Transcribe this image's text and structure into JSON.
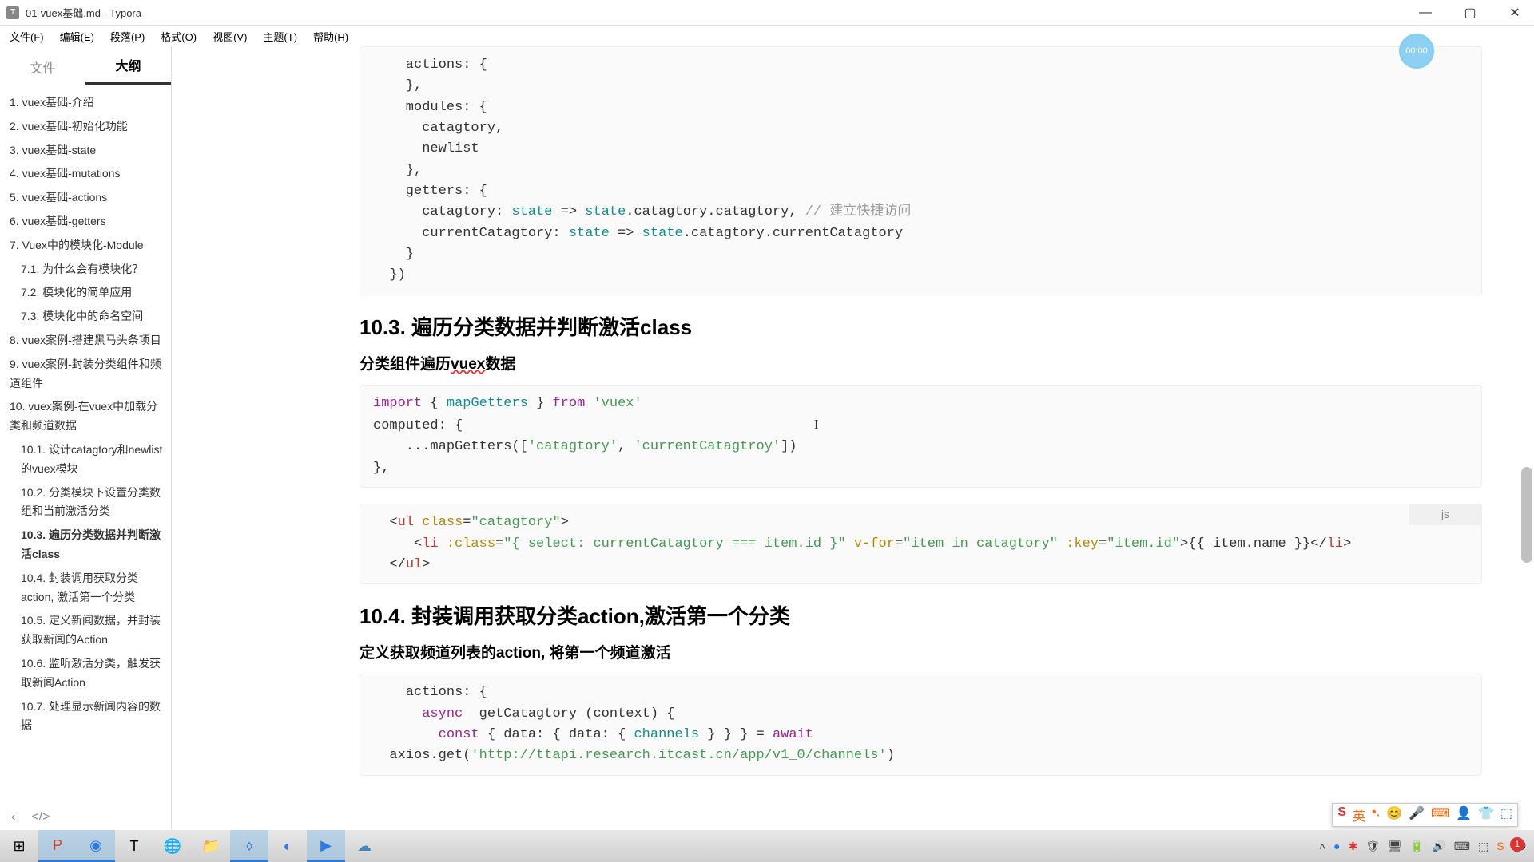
{
  "window": {
    "title": "01-vuex基础.md - Typora"
  },
  "menu": [
    "文件(F)",
    "编辑(E)",
    "段落(P)",
    "格式(O)",
    "视图(V)",
    "主题(T)",
    "帮助(H)"
  ],
  "sidebar": {
    "tabs": {
      "files": "文件",
      "outline": "大纲"
    },
    "items": [
      {
        "t": "1.  vuex基础-介绍",
        "l": 1
      },
      {
        "t": "2.  vuex基础-初始化功能",
        "l": 1
      },
      {
        "t": "3.  vuex基础-state",
        "l": 1
      },
      {
        "t": "4.  vuex基础-mutations",
        "l": 1
      },
      {
        "t": "5.  vuex基础-actions",
        "l": 1
      },
      {
        "t": "6.  vuex基础-getters",
        "l": 1
      },
      {
        "t": "7.  Vuex中的模块化-Module",
        "l": 1
      },
      {
        "t": "7.1.  为什么会有模块化？",
        "l": 2
      },
      {
        "t": "7.2.  模块化的简单应用",
        "l": 2
      },
      {
        "t": "7.3.  模块化中的命名空间",
        "l": 2
      },
      {
        "t": "8.  vuex案例-搭建黑马头条项目",
        "l": 1
      },
      {
        "t": "9.  vuex案例-封装分类组件和频道组件",
        "l": 1
      },
      {
        "t": "10.  vuex案例-在vuex中加载分类和频道数据",
        "l": 1
      },
      {
        "t": "10.1.  设计catagtory和newlist的vuex模块",
        "l": 2
      },
      {
        "t": "10.2.  分类模块下设置分类数组和当前激活分类",
        "l": 2
      },
      {
        "t": "10.3.  遍历分类数据并判断激活class",
        "l": 2,
        "a": true
      },
      {
        "t": "10.4.  封装调用获取分类action, 激活第一个分类",
        "l": 2
      },
      {
        "t": "10.5.  定义新闻数据，并封装获取新闻的Action",
        "l": 2
      },
      {
        "t": "10.6.  监听激活分类，触发获取新闻Action",
        "l": 2
      },
      {
        "t": "10.7.  处理显示新闻内容的数据",
        "l": 2
      }
    ]
  },
  "float": {
    "timer": "00:00"
  },
  "content": {
    "h2_103": "10.3. 遍历分类数据并判断激活class",
    "sub_103_a": "分类组件遍历",
    "sub_103_b": "vuex",
    "sub_103_c": "数据",
    "code2_lang": "js",
    "h2_104": "10.4. 封装调用获取分类action,激活第一个分类",
    "sub_104": "定义获取频道列表的action,  将第一个频道激活",
    "code0": {
      "l1a": "    actions: {",
      "l1b": "    },",
      "l2a": "    modules: {",
      "l2b": "      catagtory,",
      "l2c": "      newlist",
      "l2d": "    },",
      "l3a": "    getters: {",
      "l3b_a": "      catagtory: ",
      "l3b_b": "state",
      "l3b_c": " => ",
      "l3b_d": "state",
      "l3b_e": ".catagtory.catagtory, ",
      "l3b_f": "// 建立快捷访问",
      "l3c_a": "      currentCatagtory: ",
      "l3c_b": "state",
      "l3c_c": " => ",
      "l3c_d": "state",
      "l3c_e": ".catagtory.currentCatagtory",
      "l3d": "    }",
      "l4": "  })"
    },
    "code1": {
      "l1_a": "import",
      "l1_b": " { ",
      "l1_c": "mapGetters",
      "l1_d": " } ",
      "l1_e": "from",
      "l1_f": " 'vuex'",
      "l2": "computed: {",
      "l3_a": "    ...mapGetters([",
      "l3_b": "'catagtory'",
      "l3_c": ", ",
      "l3_d": "'currentCatagtroy'",
      "l3_e": "])",
      "l4": "},"
    },
    "code2": {
      "l1_a": "  <",
      "l1_b": "ul",
      "l1_c": " class",
      "l1_d": "=",
      "l1_e": "\"catagtory\"",
      "l1_f": ">",
      "l2_a": "     <",
      "l2_b": "li",
      "l2_c": " :class",
      "l2_d": "=",
      "l2_e": "\"{ select: currentCatagtory === item.id }\"",
      "l2_f": " v-for",
      "l2_g": "=",
      "l2_h": "\"item in catagtory\"",
      "l2_i": " :key",
      "l2_j": "=",
      "l2_k": "\"item.id\"",
      "l2_l": ">{{ item.name }}</",
      "l2_m": "li",
      "l2_n": ">",
      "l3_a": "  </",
      "l3_b": "ul",
      "l3_c": ">"
    },
    "code3": {
      "l1": "    actions: {",
      "l2_a": "      ",
      "l2_b": "async",
      "l2_c": "  getCatagtory (context) {",
      "l3_a": "        ",
      "l3_b": "const",
      "l3_c": " { data: { data: { ",
      "l3_d": "channels",
      "l3_e": " } } } = ",
      "l3_f": "await",
      "l4_a": "  axios.get(",
      "l4_b": "'http://ttapi.research.itcast.cn/app/v1_0/channels'",
      "l4_c": ")"
    }
  },
  "tray": {
    "ime": "英",
    "notif": "1"
  }
}
